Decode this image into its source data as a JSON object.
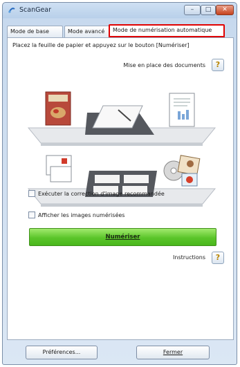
{
  "window": {
    "title": "ScanGear"
  },
  "title_buttons": {
    "minimize": "–",
    "maximize": "□",
    "close": "✕"
  },
  "tabs": [
    {
      "label": "Mode de base"
    },
    {
      "label": "Mode avancé"
    },
    {
      "label": "Mode de numérisation automatique"
    }
  ],
  "panel": {
    "instruction": "Placez la feuille de papier et appuyez sur le bouton [Numériser]",
    "doc_setup_label": "Mise en place des documents",
    "help_icon_text": "?",
    "checkbox_correction": "Exécuter la correction d'image recommandée",
    "checkbox_show": "Afficher les images numérisées",
    "scan_button": "Numériser",
    "instructions_label": "Instructions"
  },
  "footer": {
    "preferences_button": "Préférences...",
    "close_button": "Fermer"
  },
  "colors": {
    "accent_red": "#e00000",
    "scan_green": "#5bc52a",
    "title_gradient": "#cfe0f3"
  }
}
